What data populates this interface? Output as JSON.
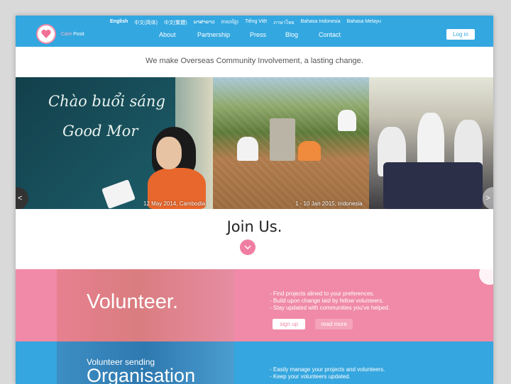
{
  "header": {
    "logo_text_1": "Care",
    "logo_text_2": "Posit",
    "languages": [
      "English",
      "中文(简体)",
      "中文(繁體)",
      "ພາສາລາວ",
      "ភាសាខ្មែរ",
      "Tiếng Việt",
      "ภาษาไทย",
      "Bahasa Indonesia",
      "Bahasa Melayu"
    ],
    "active_language": "English",
    "nav": {
      "about": "About",
      "partnership": "Partnership",
      "press": "Press",
      "blog": "Blog",
      "contact": "Contact"
    },
    "login_label": "Log in"
  },
  "tagline": "We make Overseas Community Involvement, a lasting change.",
  "hero": {
    "chalk_line_1": "Chào buổi sáng",
    "chalk_line_2": "Good Mor",
    "caption_1": "12 May 2014, Cambodia",
    "caption_2": "1 - 10 Jan 2015, Indonesia",
    "arrow_left": "<",
    "arrow_right": ">"
  },
  "join": {
    "title": "Join Us."
  },
  "volunteer": {
    "title": "Volunteer.",
    "bullets": [
      "- Find projects alined to your preferences.",
      "- Build upon change laid by fellow volunteers.",
      "- Stay updated with communities you've helped."
    ],
    "signup_label": "sign up",
    "readmore_label": "read more"
  },
  "organisation": {
    "subtitle": "Volunteer sending",
    "title": "Organisation",
    "bullets": [
      "- Easily manage your projects and volunteers.",
      "- Keep your volunteers updated."
    ]
  },
  "colors": {
    "header_blue": "#33a7e0",
    "pink": "#f08aa8",
    "org_blue": "#35a6df"
  }
}
